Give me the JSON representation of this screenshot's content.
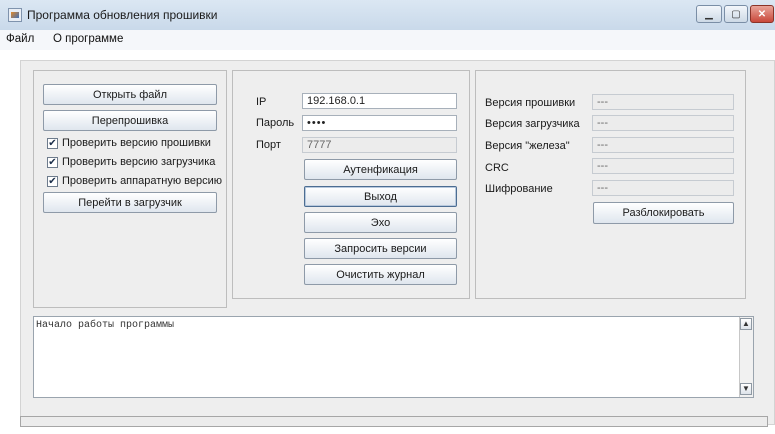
{
  "window": {
    "title": "Программа обновления прошивки"
  },
  "menu": {
    "items": [
      "Файл",
      "О программе"
    ]
  },
  "left_panel": {
    "open_file": "Открыть файл",
    "flash": "Перепрошивка",
    "checks": [
      {
        "label": "Проверить версию прошивки",
        "checked": true
      },
      {
        "label": "Проверить версию загрузчика",
        "checked": true
      },
      {
        "label": "Проверить аппаратную версию",
        "checked": true
      }
    ],
    "goto_bootloader": "Перейти в загрузчик"
  },
  "connection": {
    "ip_label": "IP",
    "ip_value": "192.168.0.1",
    "password_label": "Пароль",
    "password_value": "••••",
    "port_label": "Порт",
    "port_value": "7777",
    "buttons": [
      "Аутенфикация",
      "Выход",
      "Эхо",
      "Запросить версии",
      "Очистить журнал"
    ]
  },
  "info": {
    "rows": [
      {
        "label": "Версия прошивки",
        "value": "---"
      },
      {
        "label": "Версия загрузчика",
        "value": "---"
      },
      {
        "label": "Версия \"железа\"",
        "value": "---"
      },
      {
        "label": "CRC",
        "value": "---"
      },
      {
        "label": "Шифрование",
        "value": "---"
      }
    ],
    "unlock": "Разблокировать"
  },
  "log": {
    "text": "Начало работы программы"
  },
  "progress": {
    "value": 0
  },
  "icons": {
    "scroll_up": "▲",
    "scroll_down": "▼",
    "check": "✔"
  }
}
